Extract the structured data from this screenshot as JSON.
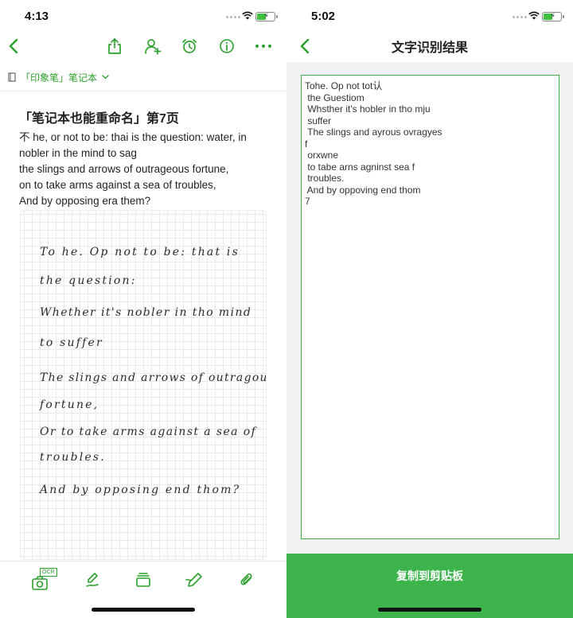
{
  "left": {
    "status": {
      "time": "4:13"
    },
    "breadcrumb": {
      "notebook": "「印象笔」笔记本"
    },
    "note": {
      "title": "「笔记本也能重命名」第7页",
      "body_lines": [
        "不 he, or not to be: thai is the question: water, in",
        "nobler in the mind to sag",
        "the slings and arrows of outrageous fortune,",
        "on to take arms against a sea of troubles,",
        "And by opposing era them?"
      ],
      "handwriting_lines": [
        "To he. Op not to be: that is",
        "the question:",
        "Whether it's nobler in tho mind",
        "to suffer",
        "The slings and arrows of outragous",
        "fortune,",
        "Or to take arms against a sea of",
        "troubles.",
        "And by opposing end thom?"
      ]
    },
    "toolbar": {
      "ocr_badge": "OCR"
    },
    "icons": {
      "back": "chevron-left-icon",
      "share": "share-icon",
      "add_user": "add-user-icon",
      "alarm": "alarm-icon",
      "info": "info-icon",
      "more": "more-icon",
      "notebook": "notebook-icon",
      "camera": "camera-ocr-icon",
      "handwrite": "handwriting-icon",
      "template": "template-icon",
      "pen": "pen-icon",
      "attach": "attachment-icon"
    }
  },
  "right": {
    "status": {
      "time": "5:02"
    },
    "title": "文字识别结果",
    "ocr_lines": [
      "Tohe. Op not tot认",
      " the Guestiom",
      " Whsther it's hobler in tho mju",
      " suffer",
      " The slings and ayrous ovragyes",
      "f",
      " orxwne",
      " to tabe arns agninst sea f",
      " troubles.",
      " And by oppoving end thom",
      "7"
    ],
    "copy_button": "复制到剪贴板"
  },
  "colors": {
    "accent": "#3cb44b",
    "accent_dark": "#2ca02c"
  }
}
